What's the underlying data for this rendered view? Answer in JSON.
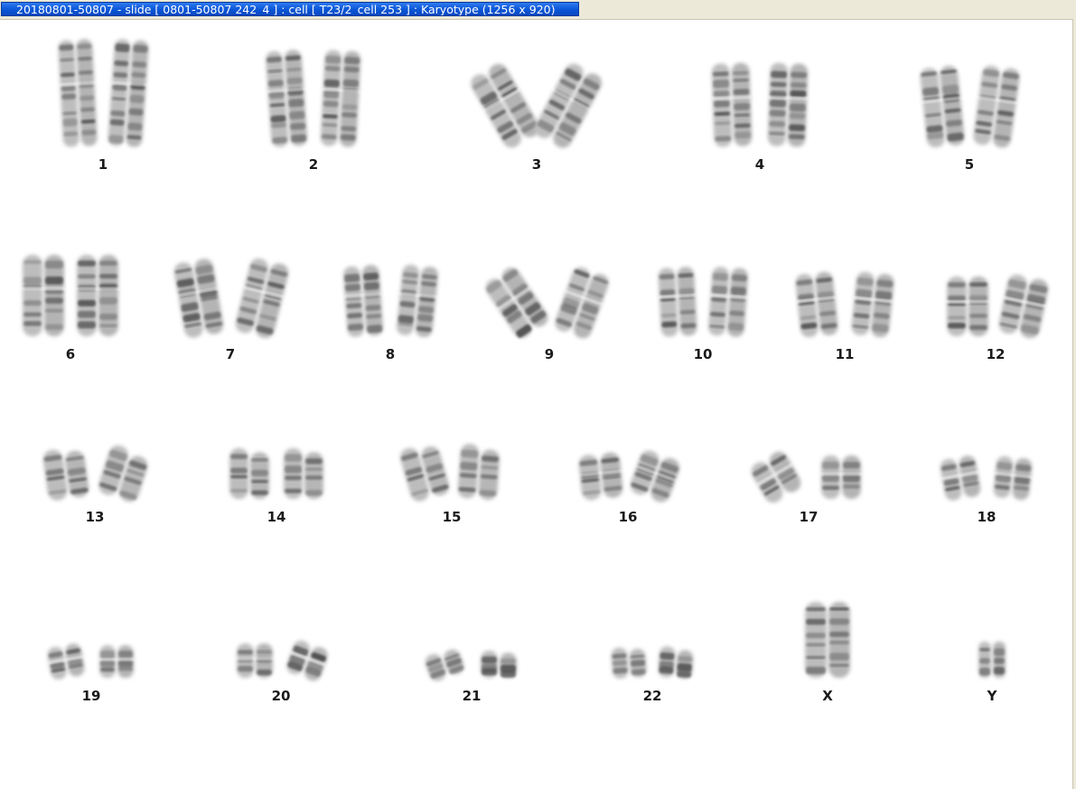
{
  "window": {
    "title": "20180801-50807 - slide [ 0801-50807 242_4 ] : cell [ T23/2_cell 253 ] : Karyotype  (1256 x 920)"
  },
  "karyotype": {
    "chromosomes": [
      {
        "id": "1"
      },
      {
        "id": "2"
      },
      {
        "id": "3"
      },
      {
        "id": "4"
      },
      {
        "id": "5"
      },
      {
        "id": "6"
      },
      {
        "id": "7"
      },
      {
        "id": "8"
      },
      {
        "id": "9"
      },
      {
        "id": "10"
      },
      {
        "id": "11"
      },
      {
        "id": "12"
      },
      {
        "id": "13"
      },
      {
        "id": "14"
      },
      {
        "id": "15"
      },
      {
        "id": "16"
      },
      {
        "id": "17"
      },
      {
        "id": "18"
      },
      {
        "id": "19"
      },
      {
        "id": "20"
      },
      {
        "id": "21"
      },
      {
        "id": "22"
      },
      {
        "id": "X"
      },
      {
        "id": "Y"
      }
    ]
  }
}
